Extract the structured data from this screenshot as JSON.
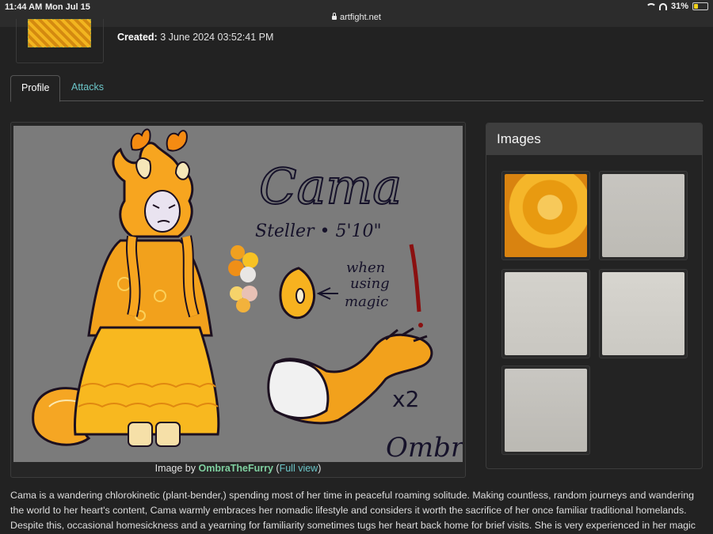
{
  "status_bar": {
    "time": "11:44 AM",
    "date": "Mon Jul 15",
    "url": "artfight.net",
    "battery": "31%",
    "battery_level": 0.31
  },
  "header": {
    "created_label": "Created:",
    "created_value": "3 June 2024 03:52:41 PM"
  },
  "tabs": [
    {
      "label": "Profile",
      "active": true
    },
    {
      "label": "Attacks",
      "active": false
    }
  ],
  "main_image": {
    "caption_prefix": "Image by ",
    "artist": "OmbraTheFurry",
    "full_view": "Full view",
    "open_paren": " (",
    "close_paren": ")",
    "drawn_text": {
      "name": "Cama",
      "height": "Steller • 5'10\"",
      "note": "when using magic",
      "multiplier": "x2",
      "signature": "Ombra"
    }
  },
  "images_panel": {
    "title": "Images",
    "count": 5
  },
  "description": "Cama is a wandering chlorokinetic (plant-bender,) spending most of her time in peaceful roaming solitude. Making countless, random journeys and wandering the world to her heart's content, Cama warmly embraces her nomadic lifestyle and considers it worth the sacrifice of her once familiar traditional homelands. Despite this, occasional homesickness and a yearning for familiarity sometimes tugs her heart back home for brief visits. She is very experienced in her magic",
  "colors": {
    "background": "#222222",
    "link": "#6cc6c9",
    "artist_link": "#7fd0a0",
    "palette": [
      "#f0a020",
      "#f7c224",
      "#ef8f17",
      "#e8e6e4",
      "#f6d36a",
      "#e8c1b5",
      "#f2b23c"
    ]
  }
}
